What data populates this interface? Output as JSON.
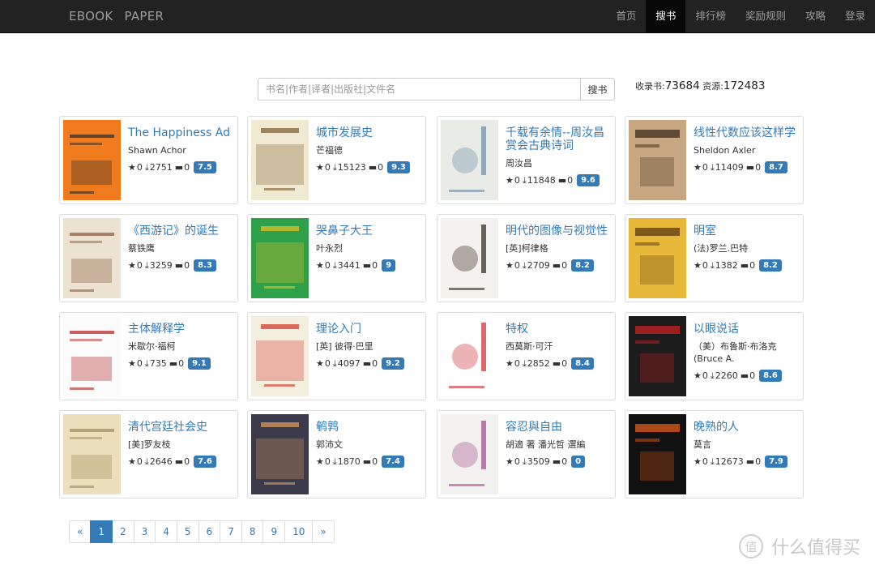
{
  "brand": {
    "part1": "EBOOK",
    "part2": "PAPER"
  },
  "nav": [
    "首页",
    "搜书",
    "排行榜",
    "奖励规则",
    "攻略",
    "登录"
  ],
  "nav_active": 1,
  "search": {
    "placeholder": "书名|作者|译者|出版社|文件名",
    "button": "搜书"
  },
  "stats": {
    "books_label": "收录书:",
    "books": "73684",
    "res_label": "资源:",
    "res": "172483"
  },
  "books": [
    {
      "title": "The Happiness Ad",
      "author": "Shawn Achor",
      "stars": "0",
      "downloads": "2751",
      "comments": "0",
      "score": "7.5",
      "cover": {
        "bg": "#f07b1c",
        "fg": "#2a2a2a"
      }
    },
    {
      "title": "城市发展史",
      "author": "芒福德",
      "stars": "0",
      "downloads": "15123",
      "comments": "0",
      "score": "9.3",
      "cover": {
        "bg": "#f1ead2",
        "fg": "#7a5a2a"
      }
    },
    {
      "title": "千载有余情--周汝昌赏会古典诗词",
      "author": "周汝昌",
      "stars": "0",
      "downloads": "11848",
      "comments": "0",
      "score": "9.6",
      "cover": {
        "bg": "#e8ebe6",
        "fg": "#6a8aa0"
      }
    },
    {
      "title": "线性代数应该这样学",
      "author": "Sheldon Axler",
      "stars": "0",
      "downloads": "11409",
      "comments": "0",
      "score": "8.7",
      "cover": {
        "bg": "#c8a882",
        "fg": "#3a2a1a"
      }
    },
    {
      "title": "《西游记》的诞生",
      "author": "蔡铁鹰",
      "stars": "0",
      "downloads": "3259",
      "comments": "0",
      "score": "8.3",
      "cover": {
        "bg": "#ece2d2",
        "fg": "#8a5a3a"
      }
    },
    {
      "title": "哭鼻子大王",
      "author": "叶永烈",
      "stars": "0",
      "downloads": "3441",
      "comments": "0",
      "score": "9",
      "cover": {
        "bg": "#2ea04a",
        "fg": "#f0c020"
      }
    },
    {
      "title": "明代的图像与视觉性",
      "author": "[英]柯律格",
      "stars": "0",
      "downloads": "2709",
      "comments": "0",
      "score": "8.2",
      "cover": {
        "bg": "#f4f2ee",
        "fg": "#2a2418"
      }
    },
    {
      "title": "明室",
      "author": "(法)罗兰.巴特",
      "stars": "0",
      "downloads": "1382",
      "comments": "0",
      "score": "8.2",
      "cover": {
        "bg": "#e8b83a",
        "fg": "#5a3a10"
      }
    },
    {
      "title": "主体解释学",
      "author": "米歇尔·福柯",
      "stars": "0",
      "downloads": "735",
      "comments": "0",
      "score": "9.1",
      "cover": {
        "bg": "#fbfbfb",
        "fg": "#b02020"
      }
    },
    {
      "title": "理论入门",
      "author": "[英] 彼得·巴里",
      "stars": "0",
      "downloads": "4097",
      "comments": "0",
      "score": "9.2",
      "cover": {
        "bg": "#f4eedf",
        "fg": "#d03020"
      }
    },
    {
      "title": "特权",
      "author": "西莫斯·可汗",
      "stars": "0",
      "downloads": "2852",
      "comments": "0",
      "score": "8.4",
      "cover": {
        "bg": "#ffffff",
        "fg": "#c8282e"
      }
    },
    {
      "title": "以眼说话",
      "author": "（美）布鲁斯·布洛克 (Bruce A.",
      "stars": "0",
      "downloads": "2260",
      "comments": "0",
      "score": "8.6",
      "cover": {
        "bg": "#1c1c1c",
        "fg": "#c82020"
      }
    },
    {
      "title": "清代宫廷社会史",
      "author": "[美]罗友枝",
      "stars": "0",
      "downloads": "2646",
      "comments": "0",
      "score": "7.6",
      "cover": {
        "bg": "#ece0bc",
        "fg": "#9a8a5a"
      }
    },
    {
      "title": "鹌鹑",
      "author": "郭沛文",
      "stars": "0",
      "downloads": "1870",
      "comments": "0",
      "score": "7.4",
      "cover": {
        "bg": "#3a3a4a",
        "fg": "#e0a060"
      }
    },
    {
      "title": "容忍與自由",
      "author": "胡適 著 潘光哲 選編",
      "stars": "0",
      "downloads": "3509",
      "comments": "0",
      "score": "0",
      "cover": {
        "bg": "#f4f2f0",
        "fg": "#a04a8a"
      }
    },
    {
      "title": "晚熟的人",
      "author": "莫言",
      "stars": "0",
      "downloads": "12673",
      "comments": "0",
      "score": "7.9",
      "cover": {
        "bg": "#111111",
        "fg": "#e05a18"
      }
    }
  ],
  "pager": [
    "«",
    "1",
    "2",
    "3",
    "4",
    "5",
    "6",
    "7",
    "8",
    "9",
    "10",
    "»"
  ],
  "pager_active": 1,
  "watermark": {
    "logo": "值",
    "text": "什么值得买"
  }
}
